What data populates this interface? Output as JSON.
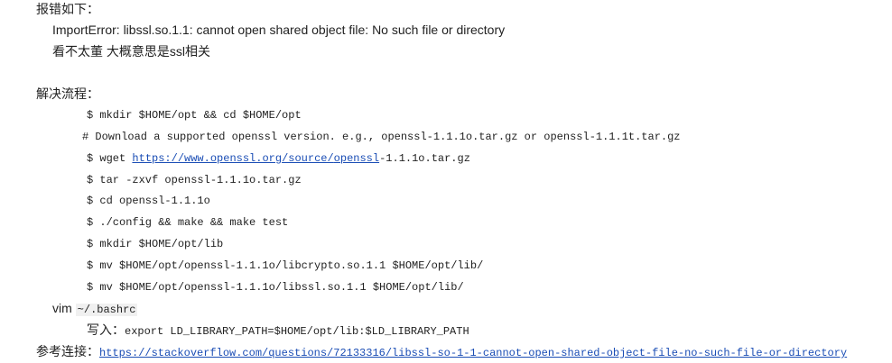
{
  "error_heading": "报错如下：",
  "error_message": "ImportError: libssl.so.1.1: cannot open shared object file: No such file or directory",
  "error_note": "看不太董 大概意思是ssl相关",
  "solution_heading": "解决流程：",
  "commands": {
    "mkdir_opt": "$ mkdir $HOME/opt && cd $HOME/opt",
    "download_comment": "# Download a supported openssl version. e.g., openssl-1.1.1o.tar.gz or openssl-1.1.1t.tar.gz",
    "wget_prefix": "$ wget ",
    "wget_link_1": "https://www.openssl.org",
    "wget_link_2": "/source/",
    "wget_link_3": "openssl",
    "wget_suffix": "-1.1.1o.tar.gz",
    "tar": "$ tar -zxvf openssl-1.1.1o.tar.gz",
    "cd": "$ cd openssl-1.1.1o",
    "config": "$ ./config && make && make test",
    "mkdir_lib": "$ mkdir $HOME/opt/lib",
    "mv_libcrypto": "$ mv $HOME/opt/openssl-1.1.1o/libcrypto.so.1.1 $HOME/opt/lib/",
    "mv_libssl": "$ mv $HOME/opt/openssl-1.1.1o/libssl.so.1.1 $HOME/opt/lib/"
  },
  "vim_prefix": "vim ",
  "vim_file": "~/.bashrc",
  "write_label": "写入：",
  "export_line": "export LD_LIBRARY_PATH=$HOME/opt/lib:$LD_LIBRARY_PATH",
  "reference_label": "参考连接：",
  "reference_url": "https://stackoverflow.com/questions/72133316/libssl-so-1-1-cannot-open-shared-object-file-no-such-file-or-directory"
}
